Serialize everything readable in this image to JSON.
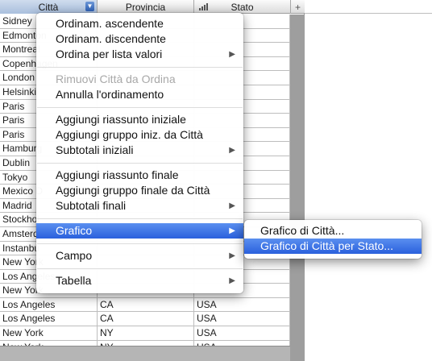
{
  "header": {
    "col1": "Città",
    "col2": "Provincia",
    "col3": "Stato",
    "add_col": "+",
    "sort_icon": "triangle-down"
  },
  "rows": [
    [
      "Sidney",
      "",
      ""
    ],
    [
      "Edmonton",
      "",
      ""
    ],
    [
      "Montreal",
      "",
      ""
    ],
    [
      "Copenhagen",
      "",
      ""
    ],
    [
      "London",
      "",
      ""
    ],
    [
      "Helsinki",
      "",
      ""
    ],
    [
      "Paris",
      "",
      ""
    ],
    [
      "Paris",
      "",
      ""
    ],
    [
      "Paris",
      "",
      ""
    ],
    [
      "Hamburg",
      "",
      ""
    ],
    [
      "Dublin",
      "",
      ""
    ],
    [
      "Tokyo",
      "",
      ""
    ],
    [
      "Mexico D",
      "",
      ""
    ],
    [
      "Madrid",
      "",
      ""
    ],
    [
      "Stockhol",
      "",
      ""
    ],
    [
      "Amsterda",
      "",
      ""
    ],
    [
      "Instanbu",
      "",
      ""
    ],
    [
      "New York",
      "",
      ""
    ],
    [
      "Los Angeles",
      "",
      ""
    ],
    [
      "New York",
      "",
      ""
    ],
    [
      "Los Angeles",
      "CA",
      "USA"
    ],
    [
      "Los Angeles",
      "CA",
      "USA"
    ],
    [
      "New York",
      "NY",
      "USA"
    ],
    [
      "New York",
      "NY",
      "USA"
    ]
  ],
  "menu": {
    "sort_asc": "Ordinam. ascendente",
    "sort_desc": "Ordinam. discendente",
    "sort_by_value_list": "Ordina per lista valori",
    "remove_sort": "Rimuovi Città da Ordina",
    "unsort": "Annulla l'ordinamento",
    "add_leading_summary": "Aggiungi riassunto iniziale",
    "add_leading_group": "Aggiungi gruppo iniz. da Città",
    "leading_subtotals": "Subtotali iniziali",
    "add_trailing_summary": "Aggiungi riassunto finale",
    "add_trailing_group": "Aggiungi gruppo finale da Città",
    "trailing_subtotals": "Subtotali finali",
    "chart": "Grafico",
    "field": "Campo",
    "table": "Tabella",
    "arrow": "▶"
  },
  "submenu": {
    "chart_city": "Grafico di Città...",
    "chart_city_by_state": "Grafico di Città per Stato..."
  },
  "colors": {
    "highlight": "#2a60dd",
    "header_selected": "#a9bfdd"
  }
}
